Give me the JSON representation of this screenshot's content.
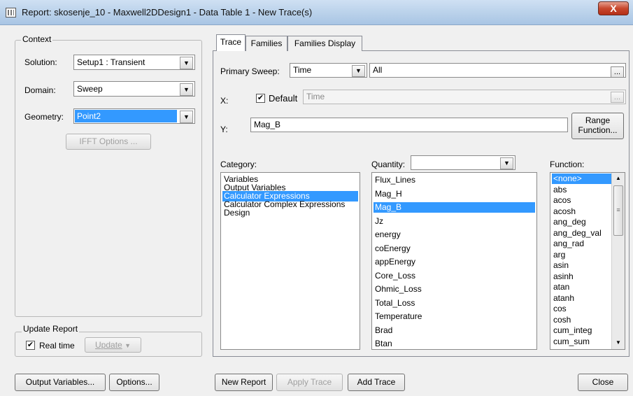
{
  "window": {
    "title": "Report: skosenje_10 - Maxwell2DDesign1 - Data Table 1 - New Trace(s)",
    "close_glyph": "X"
  },
  "context": {
    "group_label": "Context",
    "solution_label": "Solution:",
    "solution_value": "Setup1 : Transient",
    "domain_label": "Domain:",
    "domain_value": "Sweep",
    "geometry_label": "Geometry:",
    "geometry_value": "Point2",
    "ifft_button": "IFFT Options ..."
  },
  "update_report": {
    "group_label": "Update Report",
    "realtime_label": "Real time",
    "realtime_checked": true,
    "update_button": "Update"
  },
  "tabs": [
    "Trace",
    "Families",
    "Families Display"
  ],
  "trace": {
    "primary_sweep_label": "Primary Sweep:",
    "primary_sweep_value": "Time",
    "primary_sweep_range": "All",
    "x_label": "X:",
    "default_label": "Default",
    "default_checked": true,
    "x_value": "Time",
    "y_label": "Y:",
    "y_value": "Mag_B",
    "range_function_line1": "Range",
    "range_function_line2": "Function...",
    "ellipsis": "..."
  },
  "category": {
    "label": "Category:",
    "items": [
      "Variables",
      "Output Variables",
      "Calculator Expressions",
      "Calculator Complex Expressions",
      "Design"
    ],
    "selected": 2
  },
  "quantity": {
    "label": "Quantity:",
    "filter_value": "",
    "items": [
      "Flux_Lines",
      "Mag_H",
      "Mag_B",
      "Jz",
      "energy",
      "coEnergy",
      "appEnergy",
      "Core_Loss",
      "Ohmic_Loss",
      "Total_Loss",
      "Temperature",
      "Brad",
      "Btan"
    ],
    "selected": 2
  },
  "function": {
    "label": "Function:",
    "items": [
      "<none>",
      "abs",
      "acos",
      "acosh",
      "ang_deg",
      "ang_deg_val",
      "ang_rad",
      "arg",
      "asin",
      "asinh",
      "atan",
      "atanh",
      "cos",
      "cosh",
      "cum_integ",
      "cum_sum"
    ],
    "selected": 0
  },
  "footer": {
    "output_variables": "Output Variables...",
    "options": "Options...",
    "new_report": "New Report",
    "apply_trace": "Apply Trace",
    "add_trace": "Add Trace",
    "close": "Close"
  }
}
